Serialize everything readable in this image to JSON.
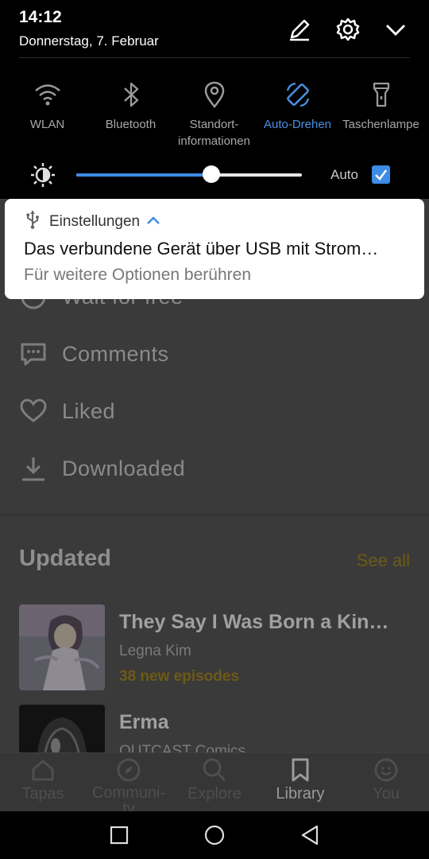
{
  "status": {
    "time": "14:12",
    "date": "Donnerstag, 7. Februar"
  },
  "header_icons": [
    "edit-icon",
    "settings-icon",
    "collapse-icon"
  ],
  "quick_tiles": [
    {
      "label": "WLAN",
      "icon": "wifi-icon",
      "active": false
    },
    {
      "label": "Bluetooth",
      "icon": "bluetooth-icon",
      "active": false
    },
    {
      "label": "Standort-\ninformationen",
      "icon": "location-icon",
      "active": false
    },
    {
      "label": "Auto-Drehen",
      "icon": "auto-rotate-icon",
      "active": true
    },
    {
      "label": "Taschenlampe",
      "icon": "flashlight-icon",
      "active": false
    }
  ],
  "brightness": {
    "level": 0.6,
    "auto_label": "Auto",
    "auto_checked": true
  },
  "notification": {
    "app": "Einstellungen",
    "title": "Das verbundene Gerät über USB mit Strom…",
    "text": "Für weitere Optionen berühren"
  },
  "library_menu": [
    {
      "label": "Wait for free",
      "icon": "clock-icon"
    },
    {
      "label": "Comments",
      "icon": "comment-icon"
    },
    {
      "label": "Liked",
      "icon": "heart-icon"
    },
    {
      "label": "Downloaded",
      "icon": "download-icon"
    }
  ],
  "updated": {
    "title": "Updated",
    "see_all": "See all",
    "items": [
      {
        "title": "They Say I Was Born a Kin…",
        "author": "Legna Kim",
        "new_episodes": "38 new episodes"
      },
      {
        "title": "Erma",
        "author": "OUTCAST Comics",
        "new_episodes": ""
      }
    ]
  },
  "bottom_nav": [
    {
      "label": "Tapas",
      "icon": "home-icon",
      "active": false
    },
    {
      "label": "Communi-\nty",
      "icon": "compass-icon",
      "active": false
    },
    {
      "label": "Explore",
      "icon": "search-icon",
      "active": false
    },
    {
      "label": "Library",
      "icon": "bookmark-icon",
      "active": true
    },
    {
      "label": "You",
      "icon": "profile-icon",
      "active": false
    }
  ],
  "colors": {
    "accent": "#3e8ce6",
    "see_all": "#6e5a16",
    "shade_bg": "#000000"
  }
}
